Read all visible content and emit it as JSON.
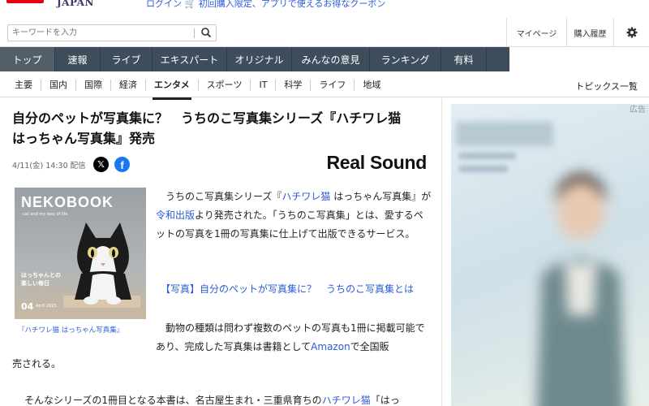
{
  "site": {
    "logo": "JAPAN",
    "promo_login": "ログイン",
    "promo_text": "初回購入限定、アプリで使えるお得なクーポン"
  },
  "search": {
    "placeholder": "キーワードを入力"
  },
  "account": {
    "mypage": "マイページ",
    "history": "購入履歴"
  },
  "main_nav": [
    {
      "label": "トップ",
      "active": true
    },
    {
      "label": "速報"
    },
    {
      "label": "ライブ"
    },
    {
      "label": "エキスパート"
    },
    {
      "label": "オリジナル"
    },
    {
      "label": "みんなの意見"
    },
    {
      "label": "ランキング"
    },
    {
      "label": "有料"
    }
  ],
  "sub_nav": [
    {
      "label": "主要"
    },
    {
      "label": "国内"
    },
    {
      "label": "国際"
    },
    {
      "label": "経済"
    },
    {
      "label": "エンタメ",
      "active": true
    },
    {
      "label": "スポーツ"
    },
    {
      "label": "IT"
    },
    {
      "label": "科学"
    },
    {
      "label": "ライフ"
    },
    {
      "label": "地域"
    }
  ],
  "topics_label": "トピックス一覧",
  "article": {
    "title_line1": "自分のペットが写真集に？　うちのこ写真集シリーズ『ハチワレ猫",
    "title_line2": "はっちゃん写真集』発売",
    "meta": "4/11(金) 14:30 配信",
    "source": "Real Sound",
    "photo": {
      "magazine": "NEKOBOOK",
      "subtitle": "cat and my way of life",
      "caption_line1": "はっちゃんとの",
      "caption_line2": "楽しい毎日",
      "issue": "04",
      "date": "April 2025"
    },
    "photo_caption": "『ハチワレ猫 はっちゃん写真集』",
    "p1_a": "うちのこ写真集シリーズ『",
    "p1_link1": "ハチワレ猫",
    "p1_b": " はっちゃん写真集』が",
    "p1_link2": "令和出版",
    "p1_c": "より発売された。「うちのこ写真集」とは、愛するペットの写真を1冊の写真集に仕上げて出版できるサービス。",
    "related": "【写真】自分のペットが写真集に？　うちのこ写真集とは",
    "p2_a": "動物の種類は問わず複数のペットの写真も1冊に掲載可能であり、完成した写真集は書籍として",
    "p2_link": "Amazon",
    "p2_b": "で全国販",
    "p2_c": "売される。",
    "p3_a": "そんなシリーズの1冊目となる本書は、名古屋生まれ・三重県育ちの",
    "p3_link": "ハチワレ猫",
    "p3_b": "「はっ"
  },
  "ad": {
    "label": "広告"
  }
}
